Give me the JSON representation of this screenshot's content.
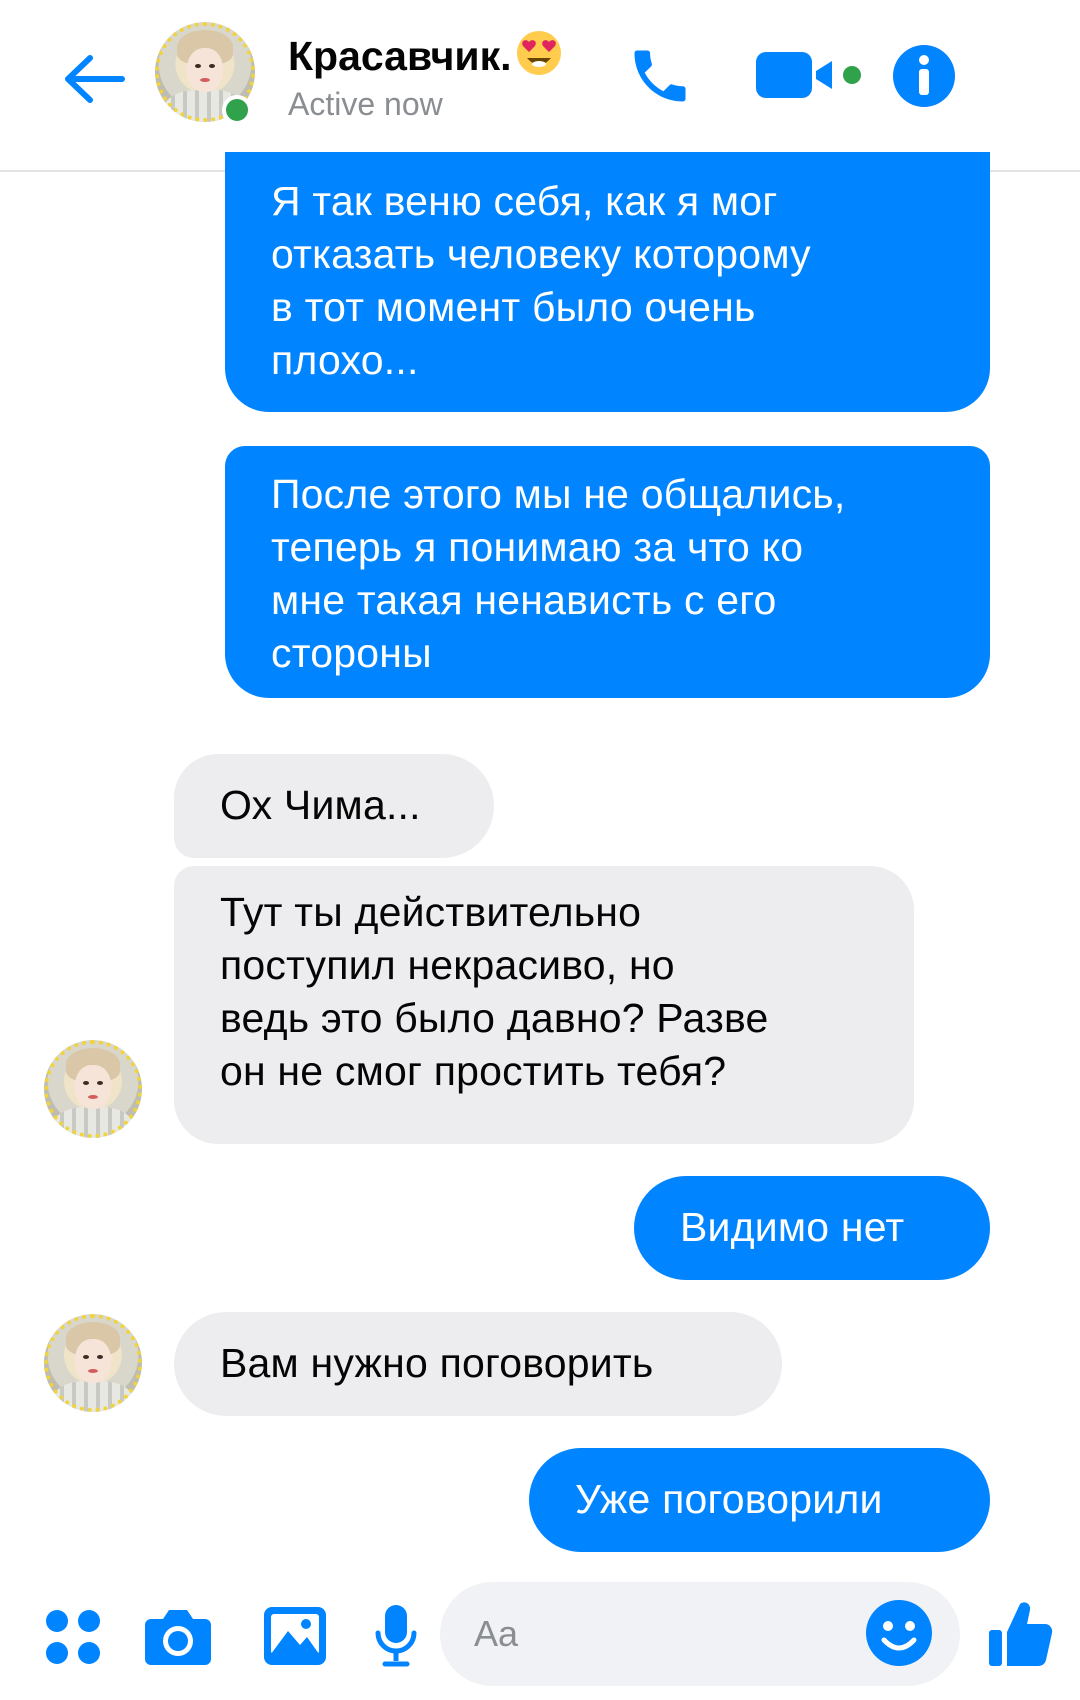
{
  "theme": {
    "accent": "#0084ff",
    "incoming_bubble": "#ededf0",
    "online": "#31a24c"
  },
  "header": {
    "contact_name": "Красавчик.",
    "name_emoji": "smiling-face-with-heart-eyes",
    "status": "Active now",
    "back_icon": "arrow-left-icon",
    "call_icon": "phone-icon",
    "video_icon": "video-camera-icon",
    "info_icon": "info-icon"
  },
  "messages": [
    {
      "direction": "outgoing",
      "lines": [
        "Я так веню себя, как я мог",
        "отказать человеку которому",
        "в тот момент было очень",
        "плохо..."
      ]
    },
    {
      "direction": "outgoing",
      "lines": [
        "После этого мы не общались,",
        "теперь я понимаю за что ко",
        "мне такая ненависть с его",
        "стороны"
      ]
    },
    {
      "direction": "incoming",
      "lines": [
        "Ох Чима..."
      ]
    },
    {
      "direction": "incoming",
      "lines": [
        "Тут ты действительно",
        "поступил некрасиво, но",
        "ведь это было давно? Разве",
        "он не смог простить тебя?"
      ]
    },
    {
      "direction": "outgoing",
      "lines": [
        "Видимо нет"
      ]
    },
    {
      "direction": "incoming",
      "lines": [
        "Вам нужно поговорить"
      ]
    },
    {
      "direction": "outgoing",
      "lines": [
        "Уже поговорили"
      ]
    }
  ],
  "composer": {
    "placeholder": "Aa",
    "menu_icon": "four-dots-icon",
    "camera_icon": "camera-icon",
    "gallery_icon": "gallery-icon",
    "mic_icon": "microphone-icon",
    "emoji_icon": "smiley-icon",
    "like_icon": "thumbs-up-icon"
  }
}
